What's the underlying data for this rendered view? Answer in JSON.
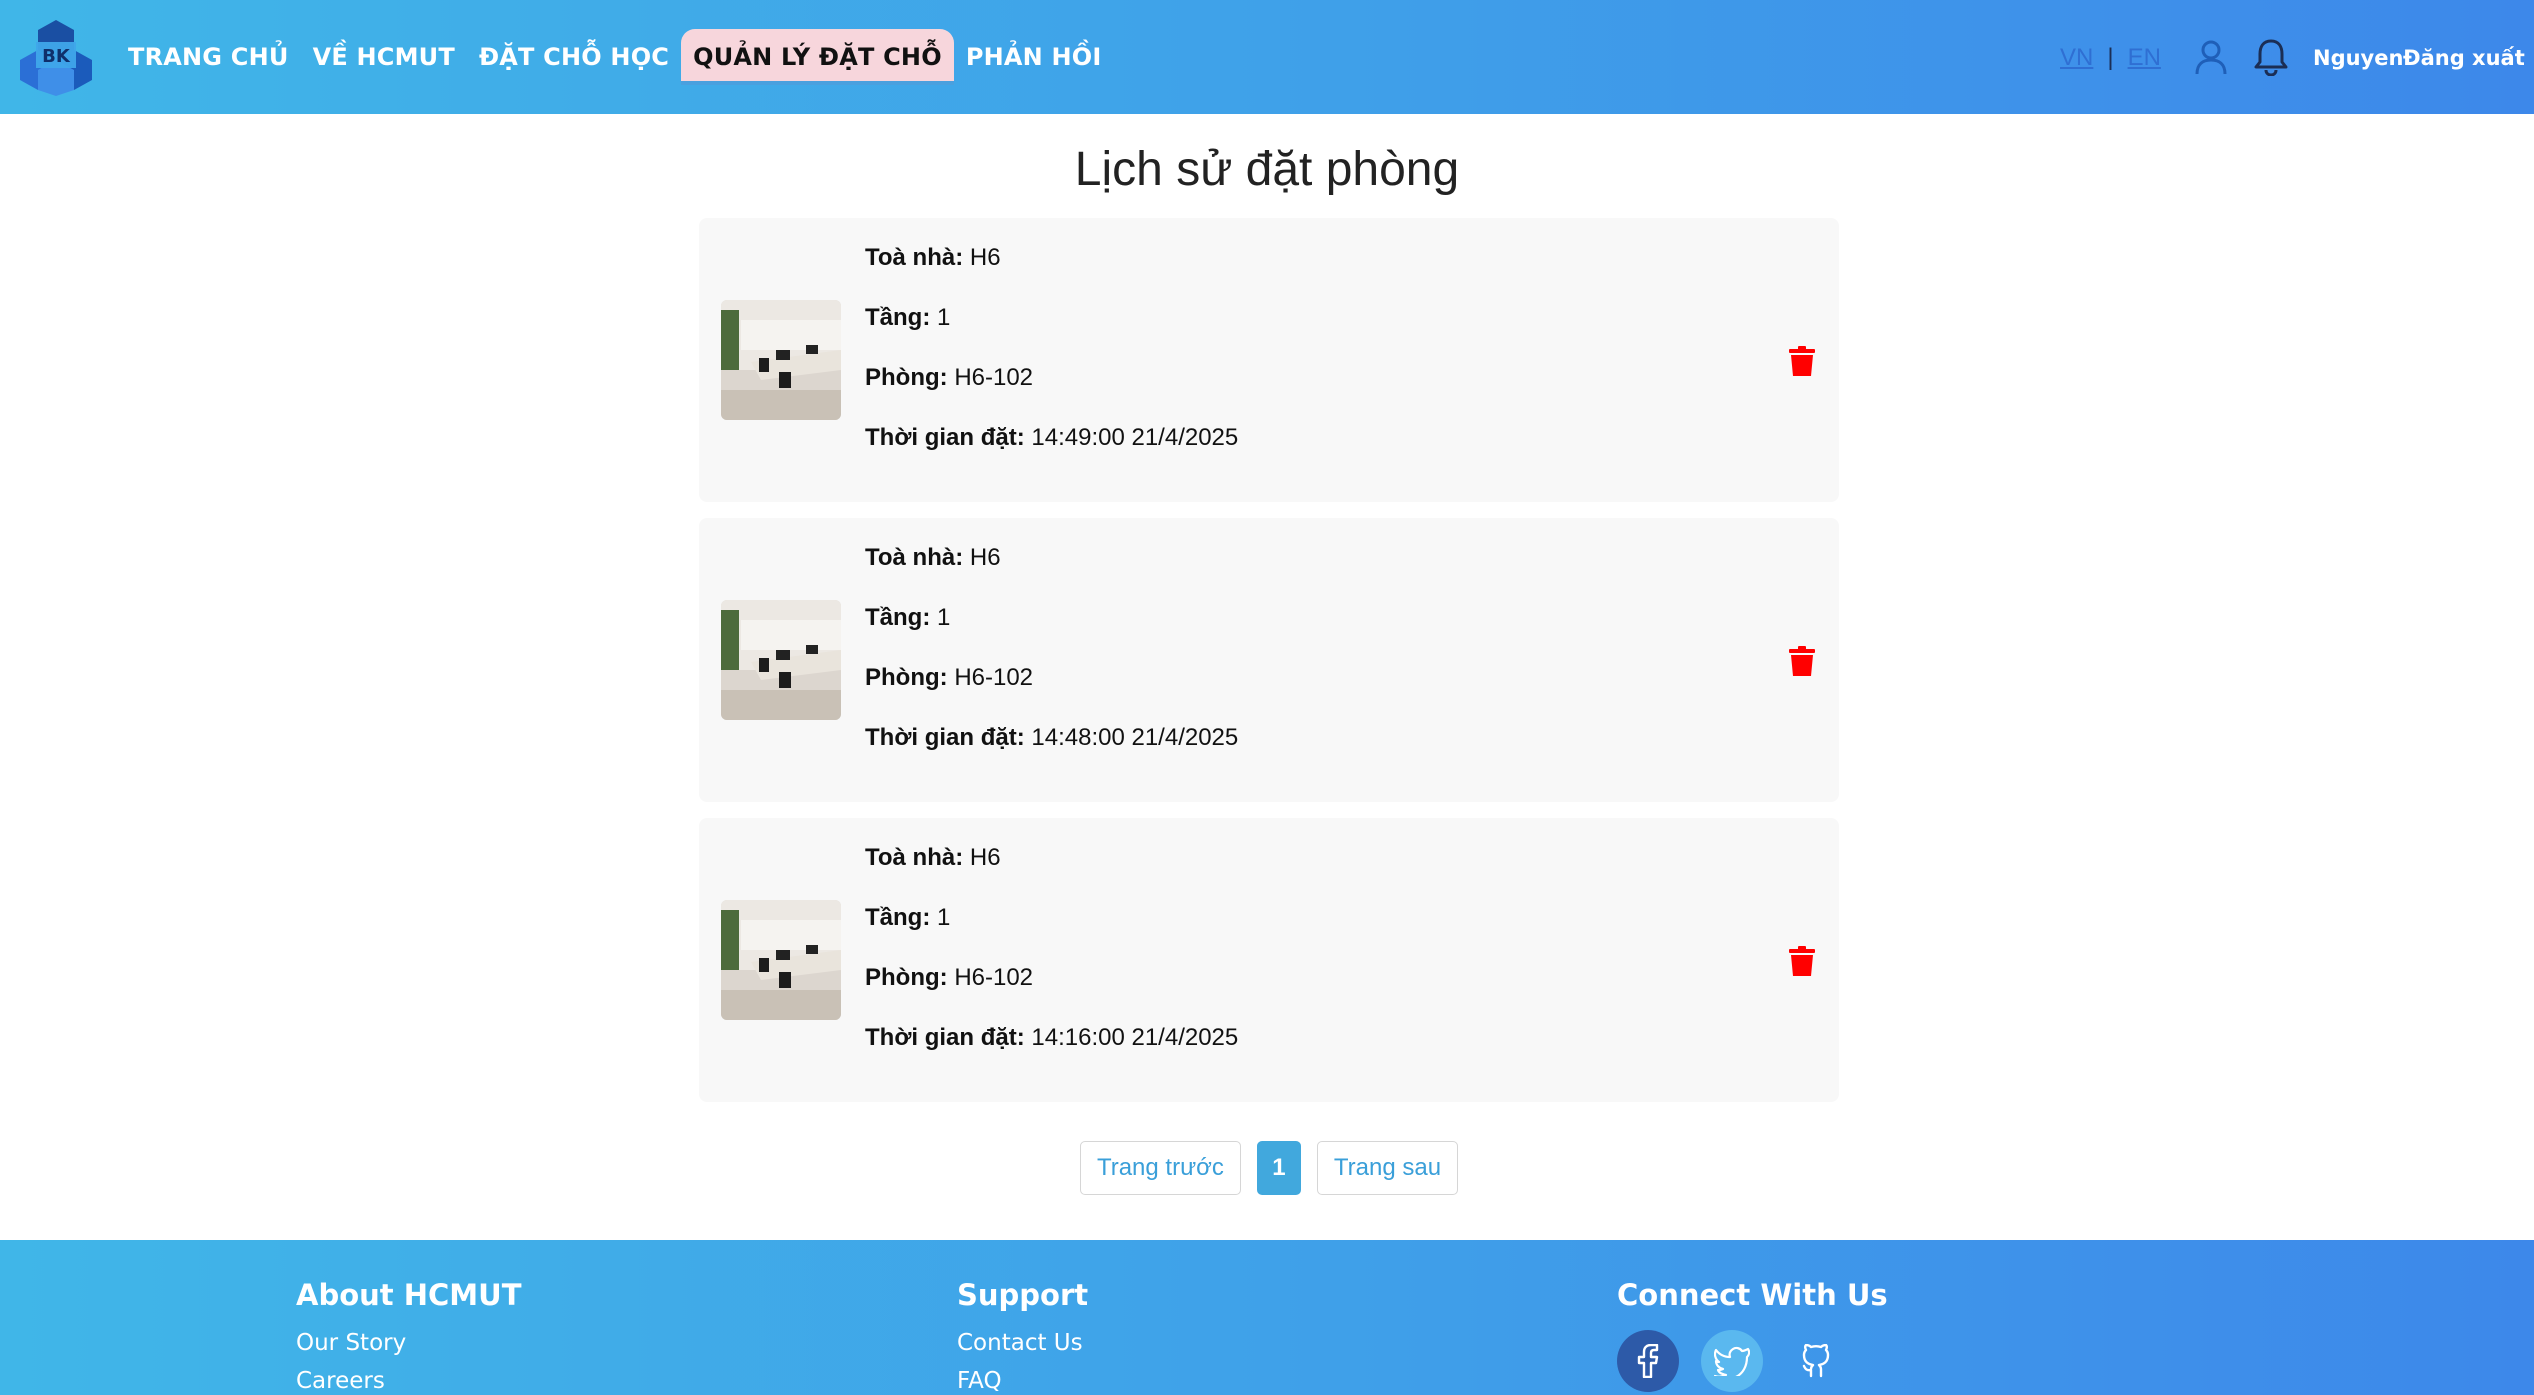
{
  "header": {
    "logo_text": "BK",
    "nav": [
      {
        "label": "TRANG CHỦ",
        "active": false
      },
      {
        "label": "VỀ HCMUT",
        "active": false
      },
      {
        "label": "ĐẶT CHỖ HỌC",
        "active": false
      },
      {
        "label": "QUẢN LÝ ĐẶT CHỖ",
        "active": true
      },
      {
        "label": "PHẢN HỒI",
        "active": false
      }
    ],
    "lang_vn": "VN",
    "lang_sep": "|",
    "lang_en": "EN",
    "username": "Nguyen",
    "logout": "Đăng xuất",
    "accent": "#40b6e8",
    "active_bg": "#f7d6dc"
  },
  "main": {
    "title": "Lịch sử đặt phòng",
    "labels": {
      "building": "Toà nhà:",
      "floor": "Tầng:",
      "room": "Phòng:",
      "time": "Thời gian đặt:"
    },
    "bookings": [
      {
        "building": "H6",
        "floor": "1",
        "room": "H6-102",
        "time": "14:49:00 21/4/2025"
      },
      {
        "building": "H6",
        "floor": "1",
        "room": "H6-102",
        "time": "14:48:00 21/4/2025"
      },
      {
        "building": "H6",
        "floor": "1",
        "room": "H6-102",
        "time": "14:16:00 21/4/2025"
      }
    ],
    "delete_color": "#ff0000"
  },
  "pagination": {
    "prev": "Trang trước",
    "current": "1",
    "next": "Trang sau"
  },
  "footer": {
    "about": {
      "title": "About HCMUT",
      "links": [
        "Our Story",
        "Careers"
      ]
    },
    "support": {
      "title": "Support",
      "links": [
        "Contact Us",
        "FAQ"
      ]
    },
    "connect": {
      "title": "Connect With Us",
      "icons": [
        "facebook-icon",
        "twitter-icon",
        "github-icon"
      ]
    }
  }
}
